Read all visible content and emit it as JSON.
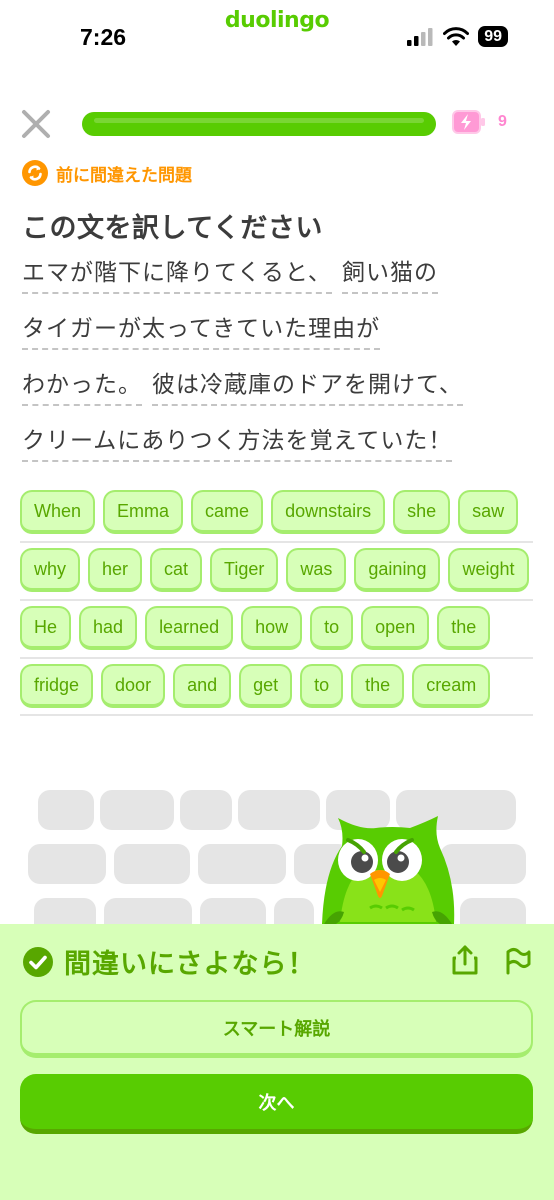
{
  "status_bar": {
    "time": "7:26",
    "brand": "duolingo",
    "battery": "99",
    "icons": [
      "signal-icon",
      "wifi-icon",
      "battery-icon"
    ]
  },
  "lesson": {
    "progress": 1.0,
    "energy_count": "9",
    "colors": {
      "progress": "#58cc02",
      "energy": "#ff86d0"
    }
  },
  "header": {
    "badge_label": "前に間違えた問題",
    "instruction": "この文を訳してください"
  },
  "sentence": {
    "lines": [
      [
        "エマが階下に降りてくると、",
        "飼い猫の"
      ],
      [
        "タイガーが太ってきていた理由が"
      ],
      [
        "わかった。",
        "彼は冷蔵庫のドアを開けて、"
      ],
      [
        "クリームにありつく方法を覚えていた！"
      ]
    ]
  },
  "word_bank": {
    "rows": [
      [
        "When",
        "Emma",
        "came",
        "downstairs",
        "she",
        "saw"
      ],
      [
        "why",
        "her",
        "cat",
        "Tiger",
        "was",
        "gaining",
        "weight"
      ],
      [
        "He",
        "had",
        "learned",
        "how",
        "to",
        "open",
        "the"
      ],
      [
        "fridge",
        "door",
        "and",
        "get",
        "to",
        "the",
        "cream"
      ]
    ]
  },
  "result": {
    "title": "間違いにさよなら！",
    "explain_button": "スマート解説",
    "next_button": "次へ",
    "colors": {
      "panel": "#d7ffb8",
      "accent": "#58a700",
      "button": "#58cc02"
    }
  }
}
